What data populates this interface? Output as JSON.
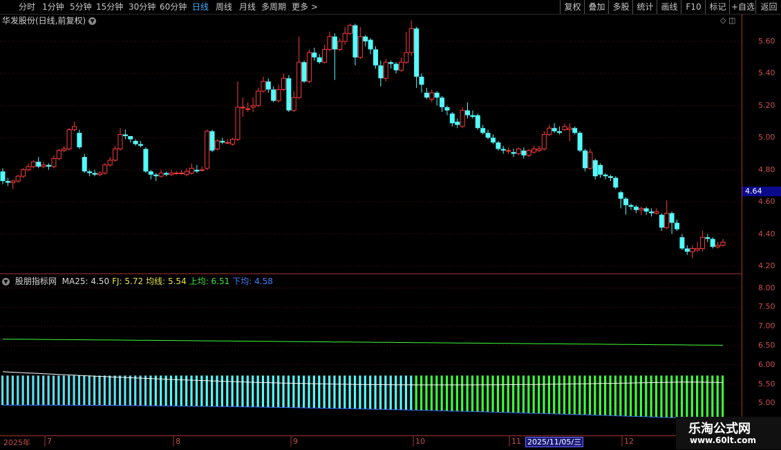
{
  "toolbar": {
    "periods": [
      {
        "label": "分时",
        "active": false
      },
      {
        "label": "1分钟",
        "active": false
      },
      {
        "label": "5分钟",
        "active": false
      },
      {
        "label": "15分钟",
        "active": false
      },
      {
        "label": "30分钟",
        "active": false
      },
      {
        "label": "60分钟",
        "active": false
      },
      {
        "label": "日线",
        "active": true
      },
      {
        "label": "周线",
        "active": false
      },
      {
        "label": "月线",
        "active": false
      },
      {
        "label": "多周期",
        "active": false
      },
      {
        "label": "更多 >",
        "active": false
      }
    ],
    "right_buttons": [
      "复权",
      "叠加",
      "多股",
      "统计",
      "画线",
      "F10",
      "标记",
      "+自选",
      "返回"
    ]
  },
  "title": {
    "stock": "华发股份(日线,前复权)",
    "dropdown_icon": "chevron-down-icon"
  },
  "price_axis": {
    "ticks": [
      "5.60",
      "5.40",
      "5.20",
      "5.00",
      "4.80",
      "4.60",
      "4.40",
      "4.20"
    ],
    "current": "4.64"
  },
  "indicator": {
    "name": "股朋指标网",
    "items": [
      {
        "label": "MA25: 4.50",
        "color": "#d8d8d8"
      },
      {
        "label": "FJ: 5.72",
        "color": "#e8e840"
      },
      {
        "label": "均线: 5.54",
        "color": "#e8e840"
      },
      {
        "label": "上均: 6.51",
        "color": "#40e840"
      },
      {
        "label": "下均: 4.58",
        "color": "#4080ff"
      }
    ],
    "axis_ticks": [
      "8.00",
      "7.50",
      "7.00",
      "6.50",
      "6.00",
      "5.50",
      "5.00"
    ]
  },
  "date_axis": {
    "labels": [
      "2025年",
      "7",
      "8",
      "9",
      "10",
      "11",
      "12"
    ],
    "selected": "2025/11/05/三"
  },
  "watermark": {
    "line1": "乐淘公式网",
    "line2": "www.60lt.com"
  },
  "colors": {
    "up": "#ff3c3c",
    "down": "#54fcfc",
    "bg": "#000000",
    "grid": "#5a1414"
  },
  "chart_data": {
    "type": "candlestick",
    "series_name": "",
    "ylim": [
      4.17,
      5.75
    ],
    "candles": [
      [
        4.79,
        4.73,
        4.81,
        4.71
      ],
      [
        4.73,
        4.72,
        4.75,
        4.7
      ],
      [
        4.72,
        4.73,
        4.74,
        4.68
      ],
      [
        4.73,
        4.76,
        4.77,
        4.72
      ],
      [
        4.76,
        4.8,
        4.81,
        4.75
      ],
      [
        4.8,
        4.82,
        4.84,
        4.79
      ],
      [
        4.82,
        4.85,
        4.86,
        4.81
      ],
      [
        4.85,
        4.82,
        4.88,
        4.81
      ],
      [
        4.82,
        4.83,
        4.85,
        4.81
      ],
      [
        4.83,
        4.82,
        4.84,
        4.8
      ],
      [
        4.82,
        4.87,
        4.89,
        4.81
      ],
      [
        4.87,
        4.92,
        4.93,
        4.86
      ],
      [
        4.92,
        4.93,
        4.95,
        4.91
      ],
      [
        4.93,
        5.05,
        5.06,
        4.92
      ],
      [
        5.05,
        5.07,
        5.1,
        5.04
      ],
      [
        5.03,
        4.94,
        5.05,
        4.93
      ],
      [
        4.88,
        4.79,
        4.9,
        4.78
      ],
      [
        4.79,
        4.78,
        4.8,
        4.76
      ],
      [
        4.78,
        4.77,
        4.8,
        4.76
      ],
      [
        4.77,
        4.78,
        4.79,
        4.76
      ],
      [
        4.78,
        4.83,
        4.84,
        4.77
      ],
      [
        4.83,
        4.86,
        4.88,
        4.82
      ],
      [
        4.86,
        4.93,
        4.95,
        4.85
      ],
      [
        4.93,
        5.02,
        5.06,
        4.92
      ],
      [
        5.02,
        5.01,
        5.05,
        4.99
      ],
      [
        5.01,
        4.99,
        5.01,
        4.97
      ],
      [
        4.98,
        4.96,
        4.99,
        4.95
      ],
      [
        4.96,
        4.95,
        4.98,
        4.94
      ],
      [
        4.93,
        4.79,
        4.94,
        4.78
      ],
      [
        4.79,
        4.77,
        4.8,
        4.74
      ],
      [
        4.77,
        4.76,
        4.78,
        4.73
      ],
      [
        4.76,
        4.78,
        4.8,
        4.75
      ],
      [
        4.78,
        4.77,
        4.79,
        4.76
      ],
      [
        4.77,
        4.78,
        4.8,
        4.76
      ],
      [
        4.78,
        4.78,
        4.79,
        4.77
      ],
      [
        4.78,
        4.78,
        4.8,
        4.77
      ],
      [
        4.77,
        4.79,
        4.81,
        4.76
      ],
      [
        4.78,
        4.81,
        4.84,
        4.77
      ],
      [
        4.8,
        4.79,
        4.83,
        4.78
      ],
      [
        4.8,
        4.8,
        4.82,
        4.79
      ],
      [
        4.81,
        5.04,
        5.05,
        4.8
      ],
      [
        5.04,
        4.92,
        5.05,
        4.91
      ],
      [
        4.93,
        4.98,
        4.99,
        4.92
      ],
      [
        4.98,
        4.97,
        5.0,
        4.96
      ],
      [
        4.97,
        4.97,
        4.99,
        4.96
      ],
      [
        4.96,
        4.99,
        5.0,
        4.95
      ],
      [
        4.99,
        5.19,
        5.35,
        4.98
      ],
      [
        5.19,
        5.19,
        5.25,
        5.13
      ],
      [
        5.18,
        5.18,
        5.22,
        5.16
      ],
      [
        5.19,
        5.2,
        5.25,
        5.16
      ],
      [
        5.2,
        5.29,
        5.31,
        5.19
      ],
      [
        5.29,
        5.35,
        5.38,
        5.28
      ],
      [
        5.35,
        5.3,
        5.37,
        5.28
      ],
      [
        5.3,
        5.23,
        5.32,
        5.22
      ],
      [
        5.23,
        5.3,
        5.33,
        5.22
      ],
      [
        5.3,
        5.37,
        5.4,
        5.29
      ],
      [
        5.37,
        5.17,
        5.39,
        5.16
      ],
      [
        5.17,
        5.25,
        5.29,
        5.16
      ],
      [
        5.25,
        5.47,
        5.63,
        5.24
      ],
      [
        5.47,
        5.35,
        5.48,
        5.34
      ],
      [
        5.35,
        5.53,
        5.55,
        5.34
      ],
      [
        5.53,
        5.5,
        5.56,
        5.48
      ],
      [
        5.5,
        5.47,
        5.52,
        5.46
      ],
      [
        5.47,
        5.55,
        5.58,
        5.46
      ],
      [
        5.55,
        5.63,
        5.66,
        5.54
      ],
      [
        5.63,
        5.55,
        5.65,
        5.36
      ],
      [
        5.55,
        5.6,
        5.62,
        5.54
      ],
      [
        5.6,
        5.65,
        5.69,
        5.58
      ],
      [
        5.65,
        5.7,
        5.71,
        5.64
      ],
      [
        5.7,
        5.5,
        5.71,
        5.45
      ],
      [
        5.5,
        5.63,
        5.69,
        5.49
      ],
      [
        5.63,
        5.6,
        5.64,
        5.57
      ],
      [
        5.61,
        5.55,
        5.62,
        5.52
      ],
      [
        5.55,
        5.45,
        5.57,
        5.43
      ],
      [
        5.45,
        5.37,
        5.48,
        5.32
      ],
      [
        5.37,
        5.47,
        5.49,
        5.35
      ],
      [
        5.47,
        5.46,
        5.48,
        5.43
      ],
      [
        5.46,
        5.42,
        5.47,
        5.4
      ],
      [
        5.42,
        5.47,
        5.5,
        5.41
      ],
      [
        5.47,
        5.53,
        5.66,
        5.46
      ],
      [
        5.53,
        5.68,
        5.73,
        5.51
      ],
      [
        5.68,
        5.38,
        5.69,
        5.31
      ],
      [
        5.38,
        5.33,
        5.4,
        5.28
      ],
      [
        5.28,
        5.25,
        5.31,
        5.24
      ],
      [
        5.24,
        5.28,
        5.3,
        5.22
      ],
      [
        5.28,
        5.25,
        5.29,
        5.2
      ],
      [
        5.25,
        5.19,
        5.26,
        5.16
      ],
      [
        5.19,
        5.17,
        5.2,
        5.14
      ],
      [
        5.15,
        5.09,
        5.16,
        5.07
      ],
      [
        5.1,
        5.08,
        5.12,
        5.06
      ],
      [
        5.07,
        5.17,
        5.19,
        5.06
      ],
      [
        5.17,
        5.14,
        5.22,
        5.12
      ],
      [
        5.14,
        5.13,
        5.17,
        5.12
      ],
      [
        5.14,
        5.06,
        5.15,
        5.05
      ],
      [
        5.06,
        5.03,
        5.08,
        5.02
      ],
      [
        5.03,
        5.0,
        5.05,
        4.99
      ],
      [
        5.0,
        4.97,
        5.02,
        4.96
      ],
      [
        4.97,
        4.93,
        4.98,
        4.92
      ],
      [
        4.93,
        4.92,
        4.95,
        4.9
      ],
      [
        4.92,
        4.92,
        4.94,
        4.9
      ],
      [
        4.91,
        4.9,
        4.93,
        4.88
      ],
      [
        4.9,
        4.93,
        4.94,
        4.89
      ],
      [
        4.92,
        4.89,
        4.94,
        4.87
      ],
      [
        4.89,
        4.92,
        4.93,
        4.88
      ],
      [
        4.91,
        4.93,
        4.95,
        4.9
      ],
      [
        4.92,
        4.93,
        4.95,
        4.91
      ],
      [
        4.93,
        5.02,
        5.04,
        4.92
      ],
      [
        5.02,
        5.06,
        5.08,
        5.01
      ],
      [
        5.06,
        5.04,
        5.09,
        5.03
      ],
      [
        5.04,
        5.03,
        5.07,
        5.02
      ],
      [
        5.05,
        5.07,
        5.09,
        5.04
      ],
      [
        5.05,
        5.06,
        5.09,
        4.98
      ],
      [
        5.06,
        5.03,
        5.07,
        5.02
      ],
      [
        5.03,
        4.92,
        5.04,
        4.91
      ],
      [
        4.92,
        4.81,
        4.93,
        4.79
      ],
      [
        4.81,
        4.91,
        4.93,
        4.8
      ],
      [
        4.86,
        4.76,
        4.87,
        4.74
      ],
      [
        4.83,
        4.77,
        4.84,
        4.75
      ],
      [
        4.77,
        4.76,
        4.78,
        4.74
      ],
      [
        4.76,
        4.75,
        4.77,
        4.73
      ],
      [
        4.75,
        4.69,
        4.76,
        4.68
      ],
      [
        4.66,
        4.62,
        4.67,
        4.56
      ],
      [
        4.62,
        4.58,
        4.63,
        4.52
      ],
      [
        4.58,
        4.57,
        4.59,
        4.55
      ],
      [
        4.57,
        4.55,
        4.58,
        4.53
      ],
      [
        4.55,
        4.56,
        4.57,
        4.52
      ],
      [
        4.56,
        4.54,
        4.57,
        4.52
      ],
      [
        4.54,
        4.53,
        4.56,
        4.51
      ],
      [
        4.53,
        4.54,
        4.56,
        4.52
      ],
      [
        4.52,
        4.44,
        4.53,
        4.42
      ],
      [
        4.44,
        4.53,
        4.61,
        4.43
      ],
      [
        4.53,
        4.47,
        4.54,
        4.4
      ],
      [
        4.47,
        4.43,
        4.49,
        4.42
      ],
      [
        4.38,
        4.31,
        4.4,
        4.3
      ],
      [
        4.31,
        4.29,
        4.33,
        4.27
      ],
      [
        4.29,
        4.31,
        4.33,
        4.25
      ],
      [
        4.3,
        4.31,
        4.35,
        4.29
      ],
      [
        4.31,
        4.38,
        4.42,
        4.29
      ],
      [
        4.38,
        4.37,
        4.4,
        4.35
      ],
      [
        4.37,
        4.32,
        4.38,
        4.31
      ],
      [
        4.32,
        4.33,
        4.35,
        4.31
      ],
      [
        4.33,
        4.35,
        4.37,
        4.32
      ]
    ],
    "indicator_series": {
      "shang_jun_start": 6.67,
      "shang_jun_end": 6.51,
      "jun_xian_start": 5.82,
      "jun_xian_peak": 5.43,
      "jun_xian_end": 5.54,
      "xia_jun_start": 4.95,
      "xia_jun_end": 4.58,
      "fj": 5.72,
      "ind_ylim": [
        4.7,
        8.3
      ]
    }
  }
}
